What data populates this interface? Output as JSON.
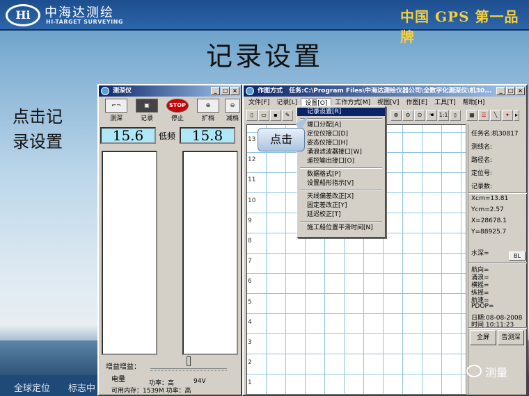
{
  "header": {
    "logo_mark": "Hi",
    "logo_cn": "中海达测绘",
    "logo_en": "HI-TARGET SURVEYING",
    "slogan": "中国 GPS 第一品牌"
  },
  "slide": {
    "title": "记录设置",
    "note_line1": "点击记",
    "note_line2": "录设置"
  },
  "footer": {
    "item1": "全球定位",
    "item2": "标志中"
  },
  "wechat": {
    "label": "测量",
    "icon": "wechat-icon"
  },
  "depth_window": {
    "title": "测深仪",
    "toolbar": [
      {
        "label": "测深",
        "icon": "sounding-icon"
      },
      {
        "label": "记录",
        "icon": "save-disk-icon"
      },
      {
        "label": "停止",
        "icon": "stop-icon",
        "icon_text": "STOP"
      },
      {
        "label": "扩档",
        "icon": "magnify-plus-icon"
      },
      {
        "label": "减档",
        "icon": "magnify-minus-icon"
      }
    ],
    "left_value": "15.6",
    "mode": "低频",
    "right_value": "15.8",
    "gain_label": "增益增益：",
    "battery_label": "电量",
    "power_text": "功率：高",
    "voltage": "94V",
    "memory_text": "可用内存：1539M  功率：高"
  },
  "plot_window": {
    "title_app": "作图方式",
    "title_task": "任务:C:\\Program Files\\中海达测绘仪器公司\\全数字化测深仪\\机30...",
    "menu": [
      "文件[F]",
      "记录[L]",
      "设置[O]",
      "工作方式[M]",
      "视图[V]",
      "作图[E]",
      "工具[T]",
      "帮助[H]"
    ],
    "y_labels": [
      "13",
      "12",
      "11",
      "10",
      "9",
      "8",
      "7",
      "6",
      "5",
      "4",
      "3",
      "2",
      "1"
    ],
    "info": {
      "task_name": "任务名:机30817",
      "line_name": "测线名:",
      "path_name": "路径名:",
      "fix_no": "定位号:",
      "record_no": "记录数:",
      "xcm": "Xcm=13.81",
      "ycm": "Ycm=2.57",
      "x": "X=28678.1",
      "y": "Y=88925.7",
      "depth": "水深=",
      "bl": "BL",
      "heading": "航向=",
      "heave": "涌浪=",
      "roll": "横摇=",
      "pitch": "纵摇=",
      "speed": "航速=",
      "pdop": "PDOP=",
      "date": "日期:08-08-2008",
      "time": "时间 10:11:23",
      "fullscreen": "全屏",
      "alarm": "告测深"
    }
  },
  "dropdown": {
    "items": [
      "记录设置[R]",
      "端口分配[A]",
      "定位仪接口[D]",
      "姿态仪接口[H]",
      "涌浪滤波器接口[W]",
      "遥控输出接口[O]",
      "数据格式[P]",
      "设置船形指示[V]",
      "天线偏差改正[X]",
      "固定差改正[Y]",
      "延迟校正[T]",
      "施工船位置平滑时间[N]"
    ]
  },
  "callout": {
    "text": "点击"
  }
}
